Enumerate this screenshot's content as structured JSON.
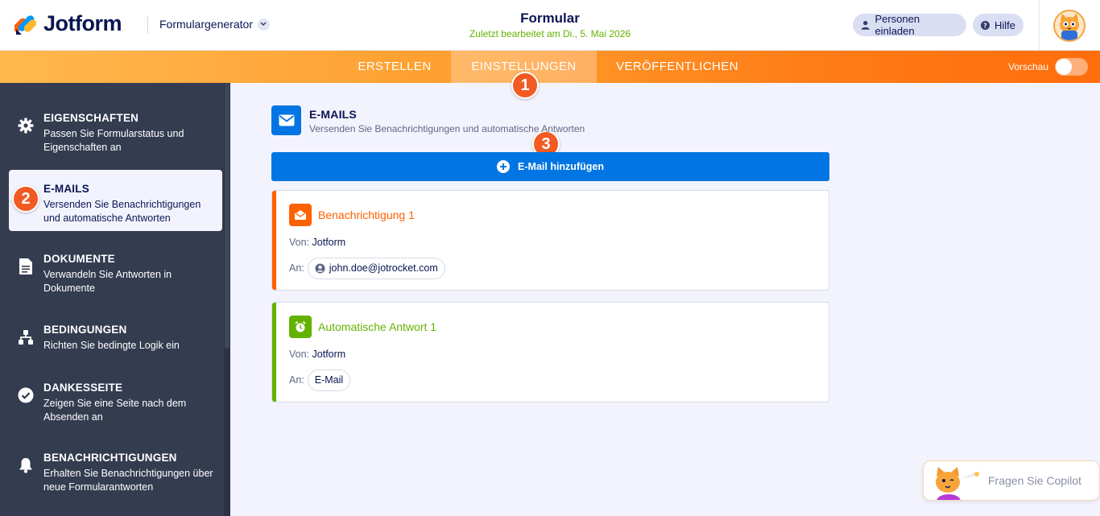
{
  "header": {
    "logo_text": "Jotform",
    "app_switcher": "Formulargenerator",
    "form_title": "Formular",
    "last_edited": "Zuletzt bearbeitet am Di., 5. Mai 2026",
    "invite_label": "Personen einladen",
    "help_label": "Hilfe"
  },
  "nav": {
    "tabs": [
      {
        "label": "ERSTELLEN"
      },
      {
        "label": "EINSTELLUNGEN",
        "active": true
      },
      {
        "label": "VERÖFFENTLICHEN"
      }
    ],
    "preview_label": "Vorschau",
    "preview_on": false
  },
  "sidebar": {
    "items": [
      {
        "title": "EIGENSCHAFTEN",
        "desc": "Passen Sie Formularstatus und Eigenschaften an",
        "icon": "gear-icon"
      },
      {
        "title": "E-MAILS",
        "desc": "Versenden Sie Benachrichtigungen und automatische Antworten",
        "icon": "email-icon",
        "active": true
      },
      {
        "title": "DOKUMENTE",
        "desc": "Verwandeln Sie Antworten in Dokumente",
        "icon": "document-icon"
      },
      {
        "title": "BEDINGUNGEN",
        "desc": "Richten Sie bedingte Logik ein",
        "icon": "conditions-icon"
      },
      {
        "title": "DANKESSEITE",
        "desc": "Zeigen Sie eine Seite nach dem Absenden an",
        "icon": "check-circle-icon"
      },
      {
        "title": "BENACHRICHTIGUNGEN",
        "desc": "Erhalten Sie Benachrichtigungen über neue Formularantworten",
        "icon": "bell-icon"
      }
    ]
  },
  "badges": [
    "1",
    "2",
    "3"
  ],
  "main": {
    "section_title": "E-MAILS",
    "section_desc": "Versenden Sie Benachrichtigungen und automatische Antworten",
    "add_button": "E-Mail hinzufügen",
    "cards": [
      {
        "title": "Benachrichtigung 1",
        "from_label": "Von:",
        "from": "Jotform",
        "to_label": "An:",
        "to": "john.doe@jotrocket.com",
        "accent": "#ff6100",
        "icon": "notification-envelope-icon"
      },
      {
        "title": "Automatische Antwort 1",
        "from_label": "Von:",
        "from": "Jotform",
        "to_label": "An:",
        "to": "E-Mail",
        "accent": "#64b200",
        "icon": "alarm-clock-icon"
      }
    ]
  },
  "copilot": {
    "label": "Fragen Sie Copilot"
  },
  "colors": {
    "primary": "#0075e3",
    "orange": "#ff6100",
    "green": "#64b200",
    "sidebar": "#343c50",
    "badge": "#f15a22"
  }
}
